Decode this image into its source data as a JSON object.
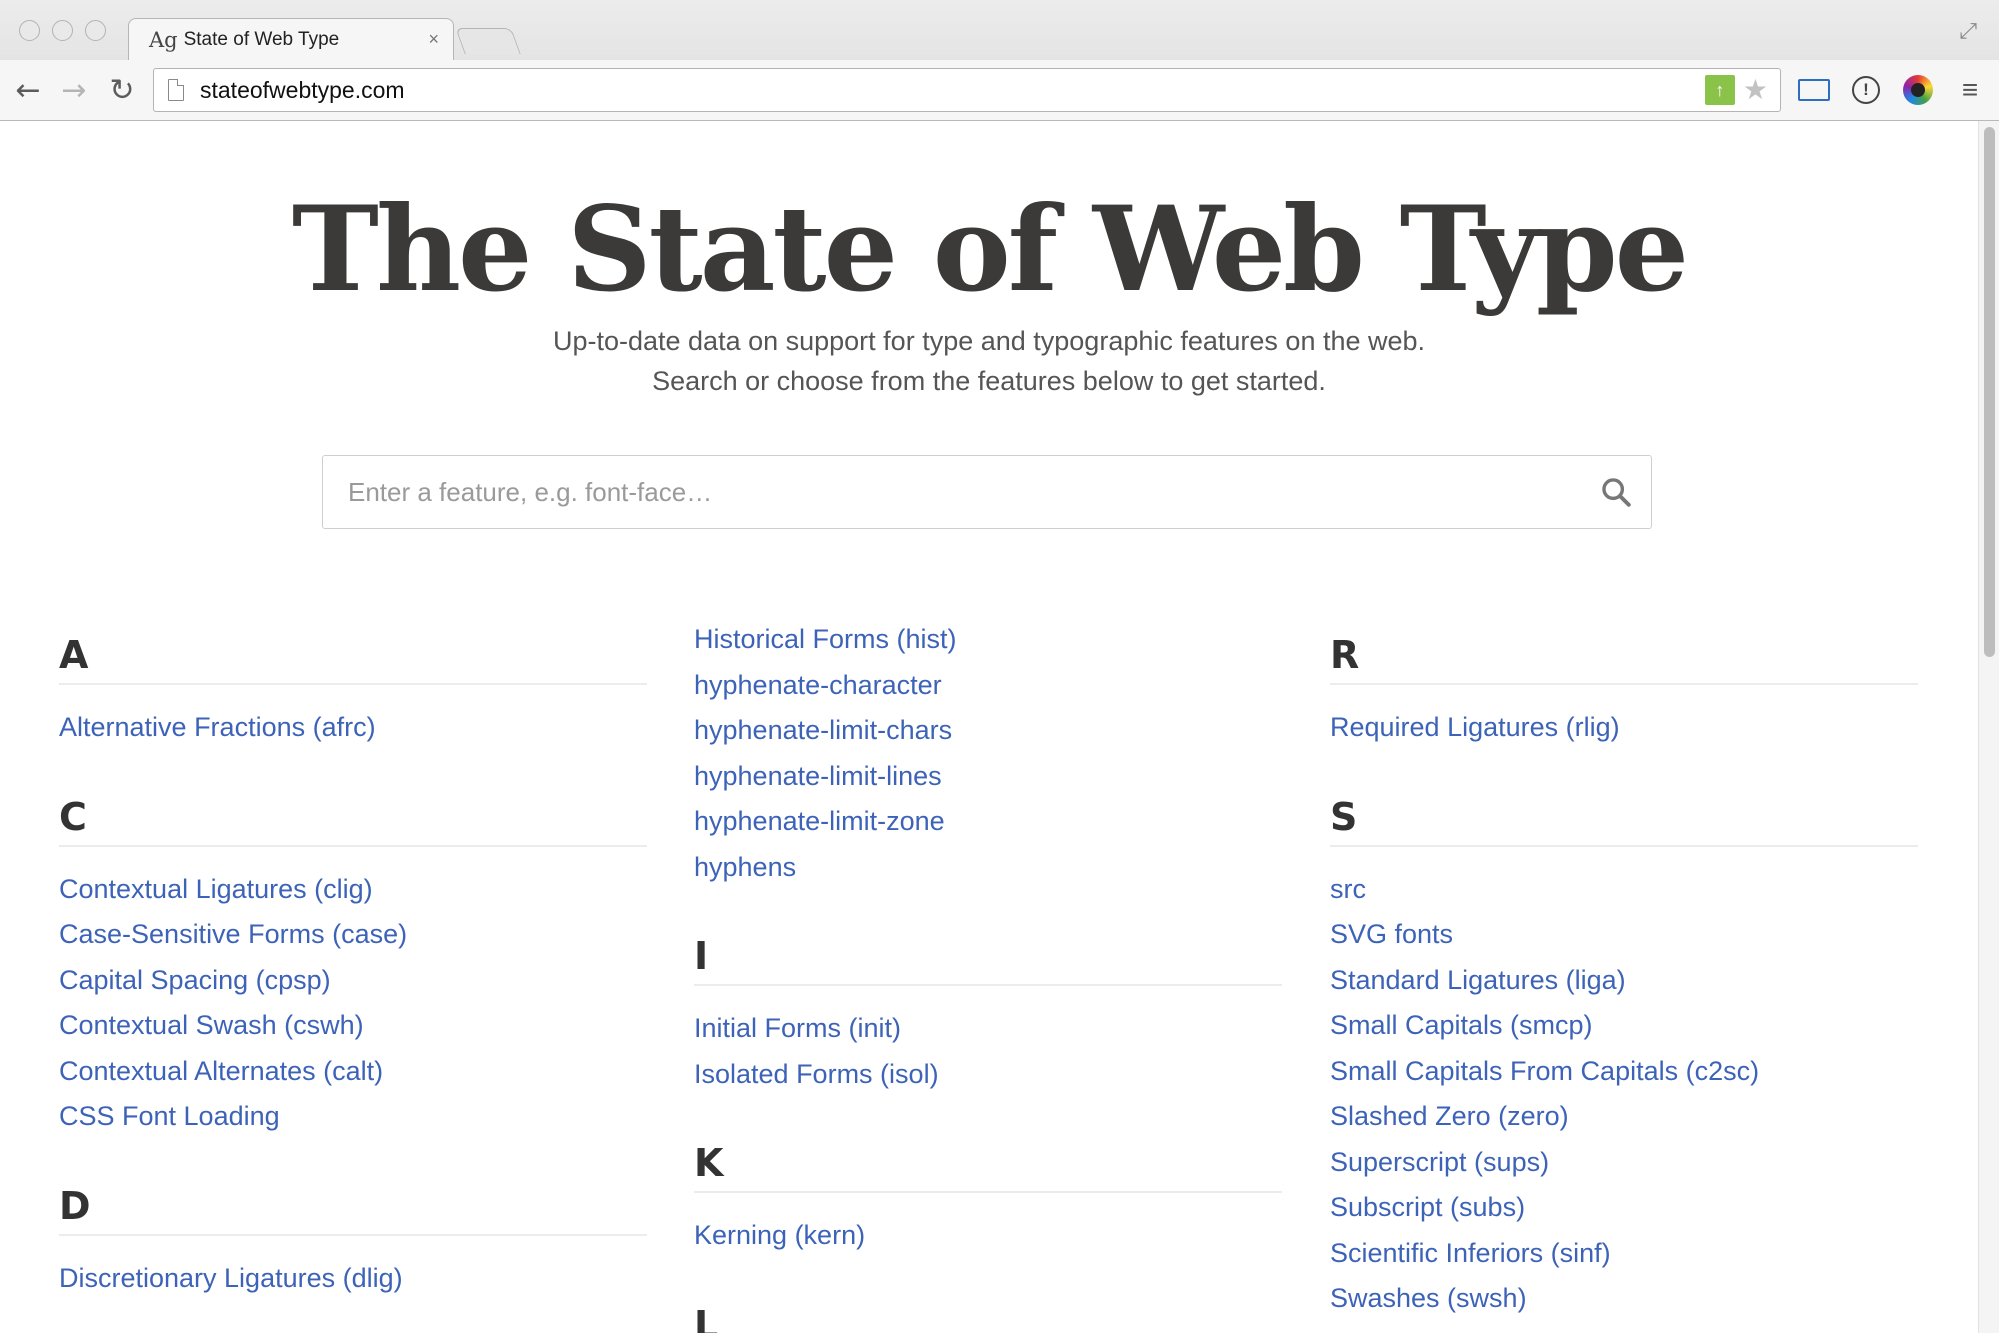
{
  "browser": {
    "tab_title": "State of Web Type",
    "tab_favicon": "Ag",
    "tab_close": "×",
    "url": "stateofwebtype.com",
    "icons": [
      "back-icon",
      "forward-icon",
      "reload-icon",
      "page-icon",
      "extension-icon",
      "star-icon",
      "cast-icon",
      "info-icon",
      "color-picker-icon",
      "menu-icon",
      "fullscreen-icon"
    ]
  },
  "page": {
    "title": "The State of Web Type",
    "tagline_line1": "Up-to-date data on support for type and typographic features on the web.",
    "tagline_line2": "Search or choose from the features below to get started.",
    "search_placeholder": "Enter a feature, e.g. font-face…"
  },
  "columns": [
    [
      {
        "letter": "A",
        "items": [
          "Alternative Fractions (afrc)"
        ]
      },
      {
        "letter": "C",
        "items": [
          "Contextual Ligatures (clig)",
          "Case-Sensitive Forms (case)",
          "Capital Spacing (cpsp)",
          "Contextual Swash (cswh)",
          "Contextual Alternates (calt)",
          "CSS Font Loading"
        ]
      },
      {
        "letter": "D",
        "items": [
          "Discretionary Ligatures (dlig)"
        ]
      }
    ],
    [
      {
        "letter": null,
        "items": [
          "Historical Forms (hist)",
          "hyphenate-character",
          "hyphenate-limit-chars",
          "hyphenate-limit-lines",
          "hyphenate-limit-zone",
          "hyphens"
        ]
      },
      {
        "letter": "I",
        "items": [
          "Initial Forms (init)",
          "Isolated Forms (isol)"
        ]
      },
      {
        "letter": "K",
        "items": [
          "Kerning (kern)"
        ]
      },
      {
        "letter": "L",
        "items": []
      }
    ],
    [
      {
        "letter": "R",
        "items": [
          "Required Ligatures (rlig)"
        ]
      },
      {
        "letter": "S",
        "items": [
          "src",
          "SVG fonts",
          "Standard Ligatures (liga)",
          "Small Capitals (smcp)",
          "Small Capitals From Capitals (c2sc)",
          "Slashed Zero (zero)",
          "Superscript (sups)",
          "Subscript (subs)",
          "Scientific Inferiors (sinf)",
          "Swashes (swsh)"
        ]
      }
    ]
  ],
  "colors": {
    "link": "#3d63b8",
    "heading": "#3b3a39",
    "text": "#555555"
  }
}
